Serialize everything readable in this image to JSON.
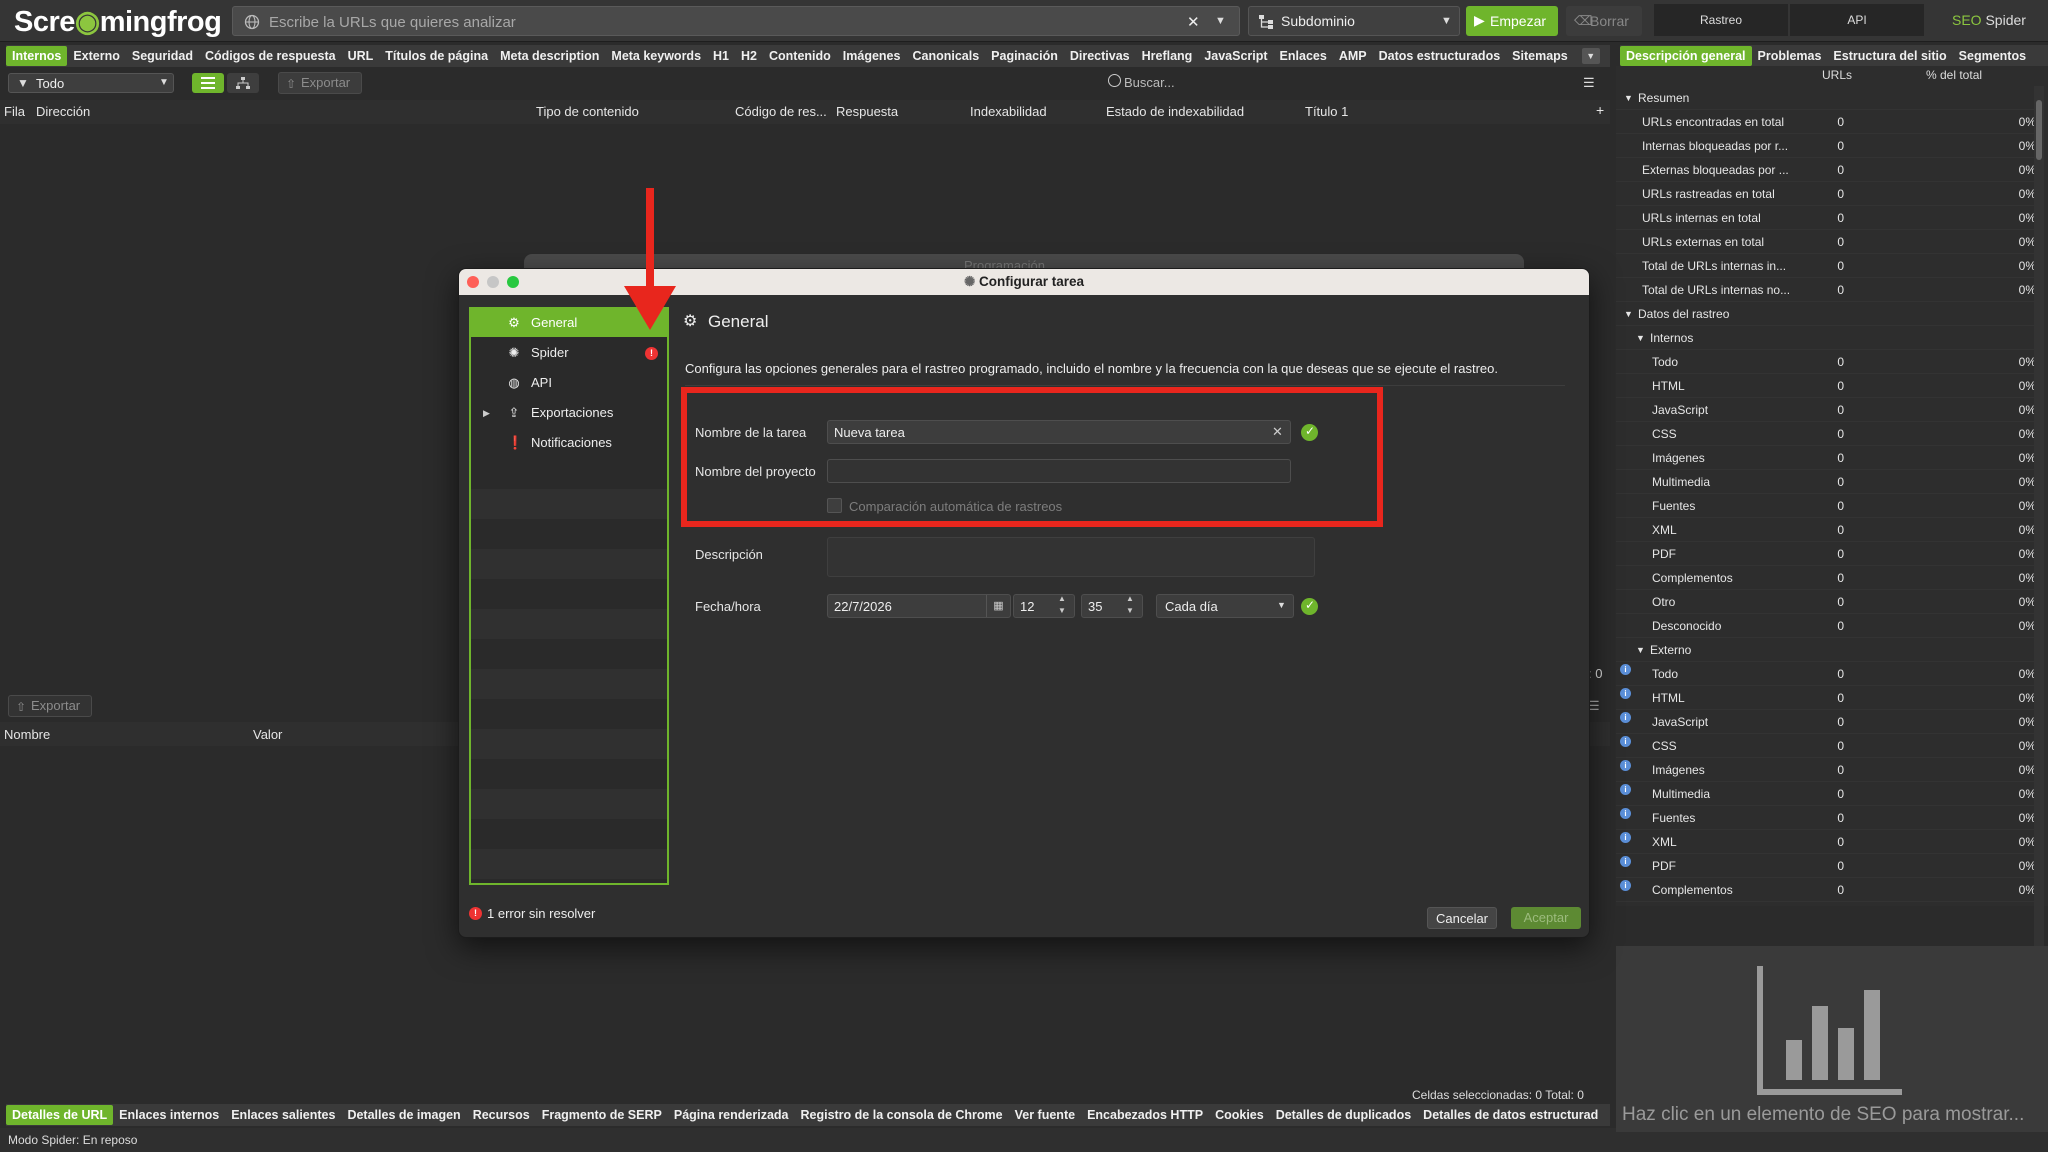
{
  "app": {
    "logo_text_a": "Scre",
    "logo_text_b": "mingfrog",
    "url_placeholder": "Escribe la URLs que quieres analizar",
    "mode": "Subdominio",
    "start": "Empezar",
    "clear": "Borrar",
    "seg_crawl": "Rastreo",
    "seg_api": "API",
    "seo_spider_a": "SEO",
    "seo_spider_b": " Spider"
  },
  "main_tabs": [
    "Internos",
    "Externo",
    "Seguridad",
    "Códigos de respuesta",
    "URL",
    "Títulos de página",
    "Meta description",
    "Meta keywords",
    "H1",
    "H2",
    "Contenido",
    "Imágenes",
    "Canonicals",
    "Paginación",
    "Directivas",
    "Hreflang",
    "JavaScript",
    "Enlaces",
    "AMP",
    "Datos estructurados",
    "Sitemaps"
  ],
  "right_tabs": [
    "Descripción general",
    "Problemas",
    "Estructura del sitio",
    "Segmentos"
  ],
  "filter": {
    "value": "Todo",
    "export": "Exportar",
    "search_placeholder": "Buscar..."
  },
  "columns": [
    "Fila",
    "Dirección",
    "Tipo de contenido",
    "Código de res...",
    "Respuesta",
    "Indexabilidad",
    "Estado de indexabilidad",
    "Título 1"
  ],
  "lower": {
    "export": "Exportar",
    "col_name": "Nombre",
    "col_value": "Valor",
    "selected_cells": "Celdas seleccionadas:  0  Total:  0",
    "count_side": ": 0"
  },
  "bottom_tabs": [
    "Detalles de URL",
    "Enlaces internos",
    "Enlaces salientes",
    "Detalles de imagen",
    "Recursos",
    "Fragmento de SERP",
    "Página renderizada",
    "Registro de la consola de Chrome",
    "Ver fuente",
    "Encabezados HTTP",
    "Cookies",
    "Detalles de duplicados",
    "Detalles de datos estructurad"
  ],
  "status_bar": "Modo Spider: En reposo",
  "overview": {
    "col_urls": "URLs",
    "col_pct": "% del total",
    "rows": [
      {
        "label": "Resumen",
        "level": 0,
        "group": true
      },
      {
        "label": "URLs encontradas en total",
        "level": 1,
        "n": "0",
        "pct": "0%"
      },
      {
        "label": "Internas bloqueadas por r...",
        "level": 1,
        "n": "0",
        "pct": "0%"
      },
      {
        "label": "Externas bloqueadas por ...",
        "level": 1,
        "n": "0",
        "pct": "0%"
      },
      {
        "label": "URLs rastreadas en total",
        "level": 1,
        "n": "0",
        "pct": "0%"
      },
      {
        "label": "URLs internas en total",
        "level": 1,
        "n": "0",
        "pct": "0%"
      },
      {
        "label": "URLs externas en total",
        "level": 1,
        "n": "0",
        "pct": "0%"
      },
      {
        "label": "Total de URLs internas in...",
        "level": 1,
        "n": "0",
        "pct": "0%"
      },
      {
        "label": "Total de URLs internas no...",
        "level": 1,
        "n": "0",
        "pct": "0%"
      },
      {
        "label": "Datos del rastreo",
        "level": 0,
        "group": true
      },
      {
        "label": "Internos",
        "level": 1,
        "group": true
      },
      {
        "label": "Todo",
        "level": 2,
        "n": "0",
        "pct": "0%"
      },
      {
        "label": "HTML",
        "level": 2,
        "n": "0",
        "pct": "0%"
      },
      {
        "label": "JavaScript",
        "level": 2,
        "n": "0",
        "pct": "0%"
      },
      {
        "label": "CSS",
        "level": 2,
        "n": "0",
        "pct": "0%"
      },
      {
        "label": "Imágenes",
        "level": 2,
        "n": "0",
        "pct": "0%"
      },
      {
        "label": "Multimedia",
        "level": 2,
        "n": "0",
        "pct": "0%"
      },
      {
        "label": "Fuentes",
        "level": 2,
        "n": "0",
        "pct": "0%"
      },
      {
        "label": "XML",
        "level": 2,
        "n": "0",
        "pct": "0%"
      },
      {
        "label": "PDF",
        "level": 2,
        "n": "0",
        "pct": "0%"
      },
      {
        "label": "Complementos",
        "level": 2,
        "n": "0",
        "pct": "0%"
      },
      {
        "label": "Otro",
        "level": 2,
        "n": "0",
        "pct": "0%"
      },
      {
        "label": "Desconocido",
        "level": 2,
        "n": "0",
        "pct": "0%"
      },
      {
        "label": "Externo",
        "level": 1,
        "group": true
      },
      {
        "label": "Todo",
        "level": 2,
        "n": "0",
        "pct": "0%",
        "info": true
      },
      {
        "label": "HTML",
        "level": 2,
        "n": "0",
        "pct": "0%",
        "info": true
      },
      {
        "label": "JavaScript",
        "level": 2,
        "n": "0",
        "pct": "0%",
        "info": true
      },
      {
        "label": "CSS",
        "level": 2,
        "n": "0",
        "pct": "0%",
        "info": true
      },
      {
        "label": "Imágenes",
        "level": 2,
        "n": "0",
        "pct": "0%",
        "info": true
      },
      {
        "label": "Multimedia",
        "level": 2,
        "n": "0",
        "pct": "0%",
        "info": true
      },
      {
        "label": "Fuentes",
        "level": 2,
        "n": "0",
        "pct": "0%",
        "info": true
      },
      {
        "label": "XML",
        "level": 2,
        "n": "0",
        "pct": "0%",
        "info": true
      },
      {
        "label": "PDF",
        "level": 2,
        "n": "0",
        "pct": "0%",
        "info": true
      },
      {
        "label": "Complementos",
        "level": 2,
        "n": "0",
        "pct": "0%",
        "info": true
      }
    ],
    "empty_hint": "Haz clic en un elemento de SEO para mostrar..."
  },
  "background_dialog_title": "Programación",
  "dialog": {
    "title": "Configurar tarea",
    "nav": [
      {
        "label": "General",
        "icon": "gear-icon",
        "active": true
      },
      {
        "label": "Spider",
        "icon": "spider-icon",
        "error": true
      },
      {
        "label": "API",
        "icon": "globe-icon"
      },
      {
        "label": "Exportaciones",
        "icon": "export-icon",
        "expandable": true
      },
      {
        "label": "Notificaciones",
        "icon": "alert-icon"
      }
    ],
    "section_title": "General",
    "description": "Configura las opciones generales para el rastreo programado, incluido el nombre y la frecuencia con la que deseas que se ejecute el rastreo.",
    "task_name_label": "Nombre de la tarea",
    "task_name_value": "Nueva tarea",
    "project_name_label": "Nombre del proyecto",
    "project_name_value": "",
    "auto_compare_label": "Comparación automática de rastreos",
    "desc_label": "Descripción",
    "datetime_label": "Fecha/hora",
    "date_value": "22/7/2026",
    "hour_value": "12",
    "minute_value": "35",
    "frequency_value": "Cada día",
    "errors": "1 error sin resolver",
    "cancel": "Cancelar",
    "accept": "Aceptar"
  },
  "colors": {
    "accent": "#6fb52c",
    "highlight": "#e8261d",
    "bg": "#2b2b2b"
  }
}
